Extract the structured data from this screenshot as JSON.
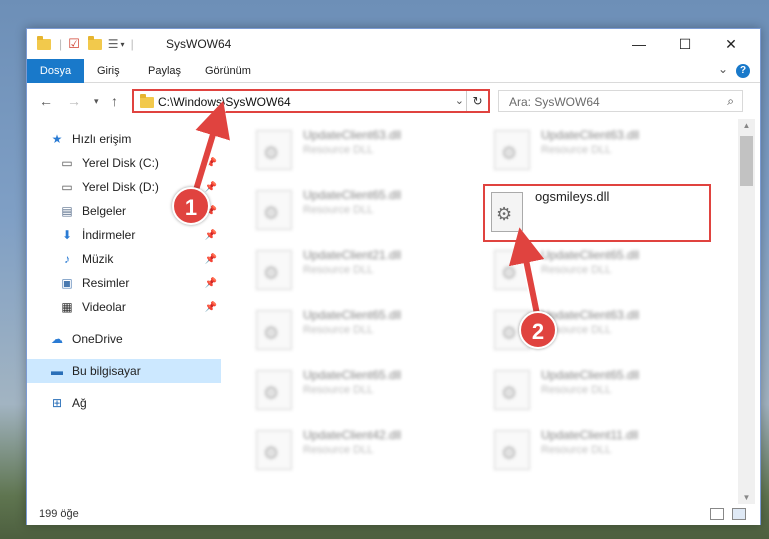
{
  "window": {
    "title": "SysWOW64"
  },
  "ribbon": {
    "tabs": [
      "Dosya",
      "Giriş",
      "Paylaş",
      "Görünüm"
    ],
    "help": "?"
  },
  "address": {
    "path": "C:\\Windows\\SysWOW64",
    "search_placeholder": "Ara: SysWOW64"
  },
  "sidebar": {
    "items": [
      {
        "label": "Hızlı erişim",
        "icon": "star-icon"
      },
      {
        "label": "Yerel Disk (C:)",
        "icon": "drive-icon"
      },
      {
        "label": "Yerel Disk (D:)",
        "icon": "drive-icon"
      },
      {
        "label": "Belgeler",
        "icon": "documents-icon"
      },
      {
        "label": "İndirmeler",
        "icon": "download-icon"
      },
      {
        "label": "Müzik",
        "icon": "music-icon"
      },
      {
        "label": "Resimler",
        "icon": "pictures-icon"
      },
      {
        "label": "Videolar",
        "icon": "video-icon"
      },
      {
        "label": "OneDrive",
        "icon": "cloud-icon"
      },
      {
        "label": "Bu bilgisayar",
        "icon": "computer-icon"
      },
      {
        "label": "Ağ",
        "icon": "network-icon"
      }
    ]
  },
  "files": {
    "left": [
      {
        "name": "UpdateClient63.dll",
        "type": "Resource DLL"
      },
      {
        "name": "UpdateClient65.dll",
        "type": "Resource DLL"
      },
      {
        "name": "UpdateClient21.dll",
        "type": "Resource DLL"
      },
      {
        "name": "UpdateClient65.dll",
        "type": "Resource DLL"
      },
      {
        "name": "UpdateClient65.dll",
        "type": "Resource DLL"
      },
      {
        "name": "UpdateClient42.dll",
        "type": "Resource DLL"
      }
    ],
    "right": [
      {
        "name": "UpdateClient63.dll",
        "type": "Resource DLL"
      },
      {
        "name": "UpdateClient65.dll",
        "type": "Resource DLL"
      },
      {
        "name": "UpdateClient63.dll",
        "type": "Resource DLL"
      },
      {
        "name": "UpdateClient65.dll",
        "type": "Resource DLL"
      },
      {
        "name": "UpdateClient11.dll",
        "type": "Resource DLL"
      }
    ],
    "highlighted": {
      "name": "ogsmileys.dll"
    }
  },
  "status": {
    "count": "199 öğe"
  },
  "annotations": {
    "step1": "1",
    "step2": "2",
    "color": "#e0433f"
  }
}
